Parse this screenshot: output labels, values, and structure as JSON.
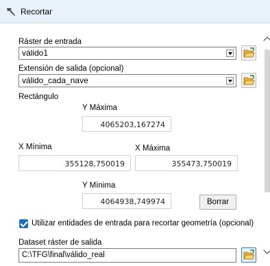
{
  "window": {
    "title": "Recortar",
    "icon": "hammer-icon"
  },
  "input_raster": {
    "label": "Ráster de entrada",
    "value": "válido1"
  },
  "output_extent": {
    "label": "Extensión de salida (opcional)",
    "value": "válido_cada_nave"
  },
  "rectangle": {
    "label": "Rectángulo",
    "y_max_label": "Y Máxima",
    "y_max": "4065203,167274",
    "x_min_label": "X Mínima",
    "x_min": "355128,750019",
    "x_max_label": "X Máxima",
    "x_max": "355473,750019",
    "y_min_label": "Y Mínima",
    "y_min": "4064938,749974",
    "clear_label": "Borrar"
  },
  "use_features": {
    "label": "Utilizar entidades de entrada para recortar geometría (opcional)",
    "checked": true
  },
  "output_dataset": {
    "label": "Dataset ráster de salida",
    "value": "C:\\TFG\\final\\válido_real"
  }
}
